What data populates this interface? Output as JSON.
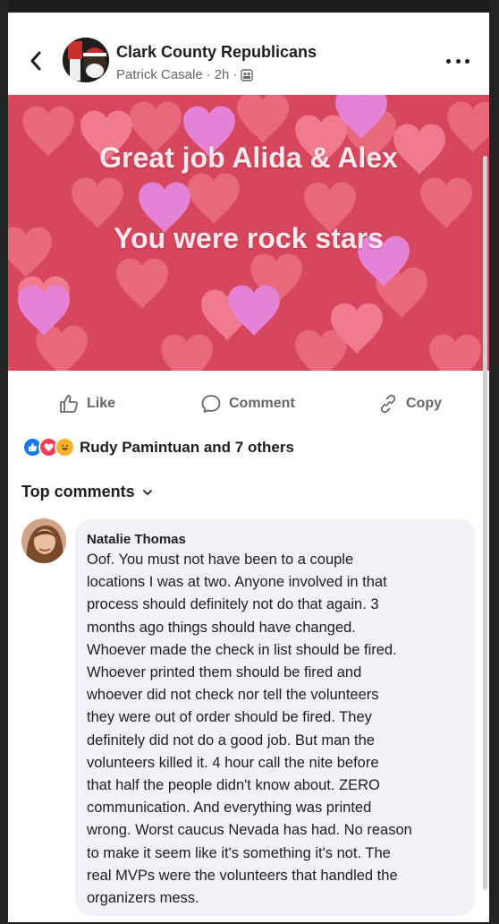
{
  "header": {
    "back_icon": "chevron-left-icon",
    "group_name": "Clark County Republicans",
    "author": "Patrick Casale",
    "time": "2h",
    "separator": "·",
    "privacy_icon": "group-members-icon",
    "more_icon": "more-dots-icon"
  },
  "post": {
    "banner_line1": "Great job Alida & Alex",
    "banner_line2": "You were rock stars",
    "banner_bg": "#d8445c"
  },
  "actions": {
    "like": "Like",
    "comment": "Comment",
    "copy": "Copy"
  },
  "reactions": {
    "types": [
      "like",
      "love",
      "haha"
    ],
    "summary": "Rudy Pamintuan and 7 others"
  },
  "comments": {
    "filter_label": "Top comments",
    "items": [
      {
        "name": "Natalie Thomas",
        "text": "Oof. You must not have been to a couple\nlocations I was at two. Anyone involved in that\nprocess should definitely not do that again. 3\nmonths ago things should have changed.\nWhoever made the check in list should be fired.\nWhoever printed them should be fired and\nwhoever did not check nor tell the volunteers\nthey were out of order should be fired. They\ndefinitely did not do a good job. But man the\nvolunteers killed it. 4 hour call the nite before\nthat half the people didn't know about. ZERO\ncommunication. And everything was printed\nwrong. Worst caucus Nevada has had. No reason\nto make it seem like it's something it's not. The\nreal MVPs were the volunteers that handled the\norganizers mess."
      }
    ]
  },
  "colors": {
    "text_primary": "#1c1e21",
    "text_secondary": "#65676b",
    "bubble_bg": "#f0f2f5",
    "like_blue": "#1877f2",
    "love_red": "#f33e58",
    "haha_yellow": "#f7b125"
  }
}
